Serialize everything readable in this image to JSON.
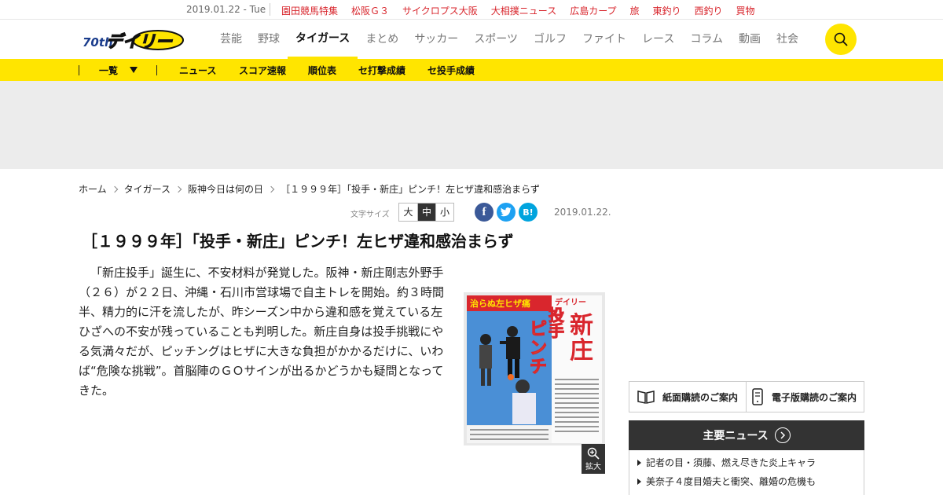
{
  "topbar": {
    "date": "2019.01.22 - Tue",
    "links": [
      "園田競馬特集",
      "松阪Ｇ３",
      "サイクロプス大阪",
      "大相撲ニュース",
      "広島カープ",
      "旅",
      "東釣り",
      "西釣り",
      "買物"
    ]
  },
  "header": {
    "logo_badge": "70th",
    "logo_text": "デイリー",
    "nav": [
      "芸能",
      "野球",
      "タイガース",
      "まとめ",
      "サッカー",
      "スポーツ",
      "ゴルフ",
      "ファイト",
      "レース",
      "コラム",
      "動画",
      "社会"
    ],
    "active_nav": "タイガース"
  },
  "subnav": {
    "list_label": "一覧",
    "items": [
      "ニュース",
      "スコア速報",
      "順位表",
      "セ打撃成績",
      "セ投手成績"
    ]
  },
  "breadcrumb": [
    "ホーム",
    "タイガース",
    "阪神今日は何の日",
    "［１９９９年］「投手・新庄」ピンチ！左ヒザ違和感治まらず"
  ],
  "article": {
    "font_size_label": "文字サイズ",
    "font_sizes": [
      "大",
      "中",
      "小"
    ],
    "font_size_selected": "中",
    "share": {
      "facebook": "f",
      "hatena": "B!"
    },
    "date": "2019.01.22.",
    "title": "［１９９９年］「投手・新庄」ピンチ！左ヒザ違和感治まらず",
    "body": "「新庄投手」誕生に、不安材料が発覚した。阪神・新庄剛志外野手（２６）が２２日、沖縄・石川市営球場で自主トレを開始。約３時間半、精力的に汗を流したが、昨シーズン中から違和感を覚えている左ひざへの不安が残っていることも判明した。新庄自身は投手挑戦にやる気満々だが、ピッチングはヒザに大きな負担がかかるだけに、いわば“危険な挑戦”。首脳陣のＧＯサインが出るかどうかも疑問となってきた。",
    "figure": {
      "headline_1": "新庄",
      "headline_2": "投手",
      "headline_3": "ピンチ",
      "banner": "治らぬ左ヒザ痛",
      "masthead": "デイリー"
    },
    "zoom_label": "拡大"
  },
  "sidebar": {
    "paper_subscription": "紙面購読のご案内",
    "digital_subscription": "電子版購読のご案内",
    "news_heading": "主要ニュース",
    "news_items": [
      "記者の目・須藤、燃え尽きた炎上キャラ",
      "美奈子４度目婚夫と衝突、離婚の危機も"
    ]
  },
  "colors": {
    "brand_yellow": "#ffe500",
    "link_red": "#d8262d",
    "facebook": "#3b5998",
    "twitter": "#1da1f2",
    "hatena": "#00a4de"
  }
}
